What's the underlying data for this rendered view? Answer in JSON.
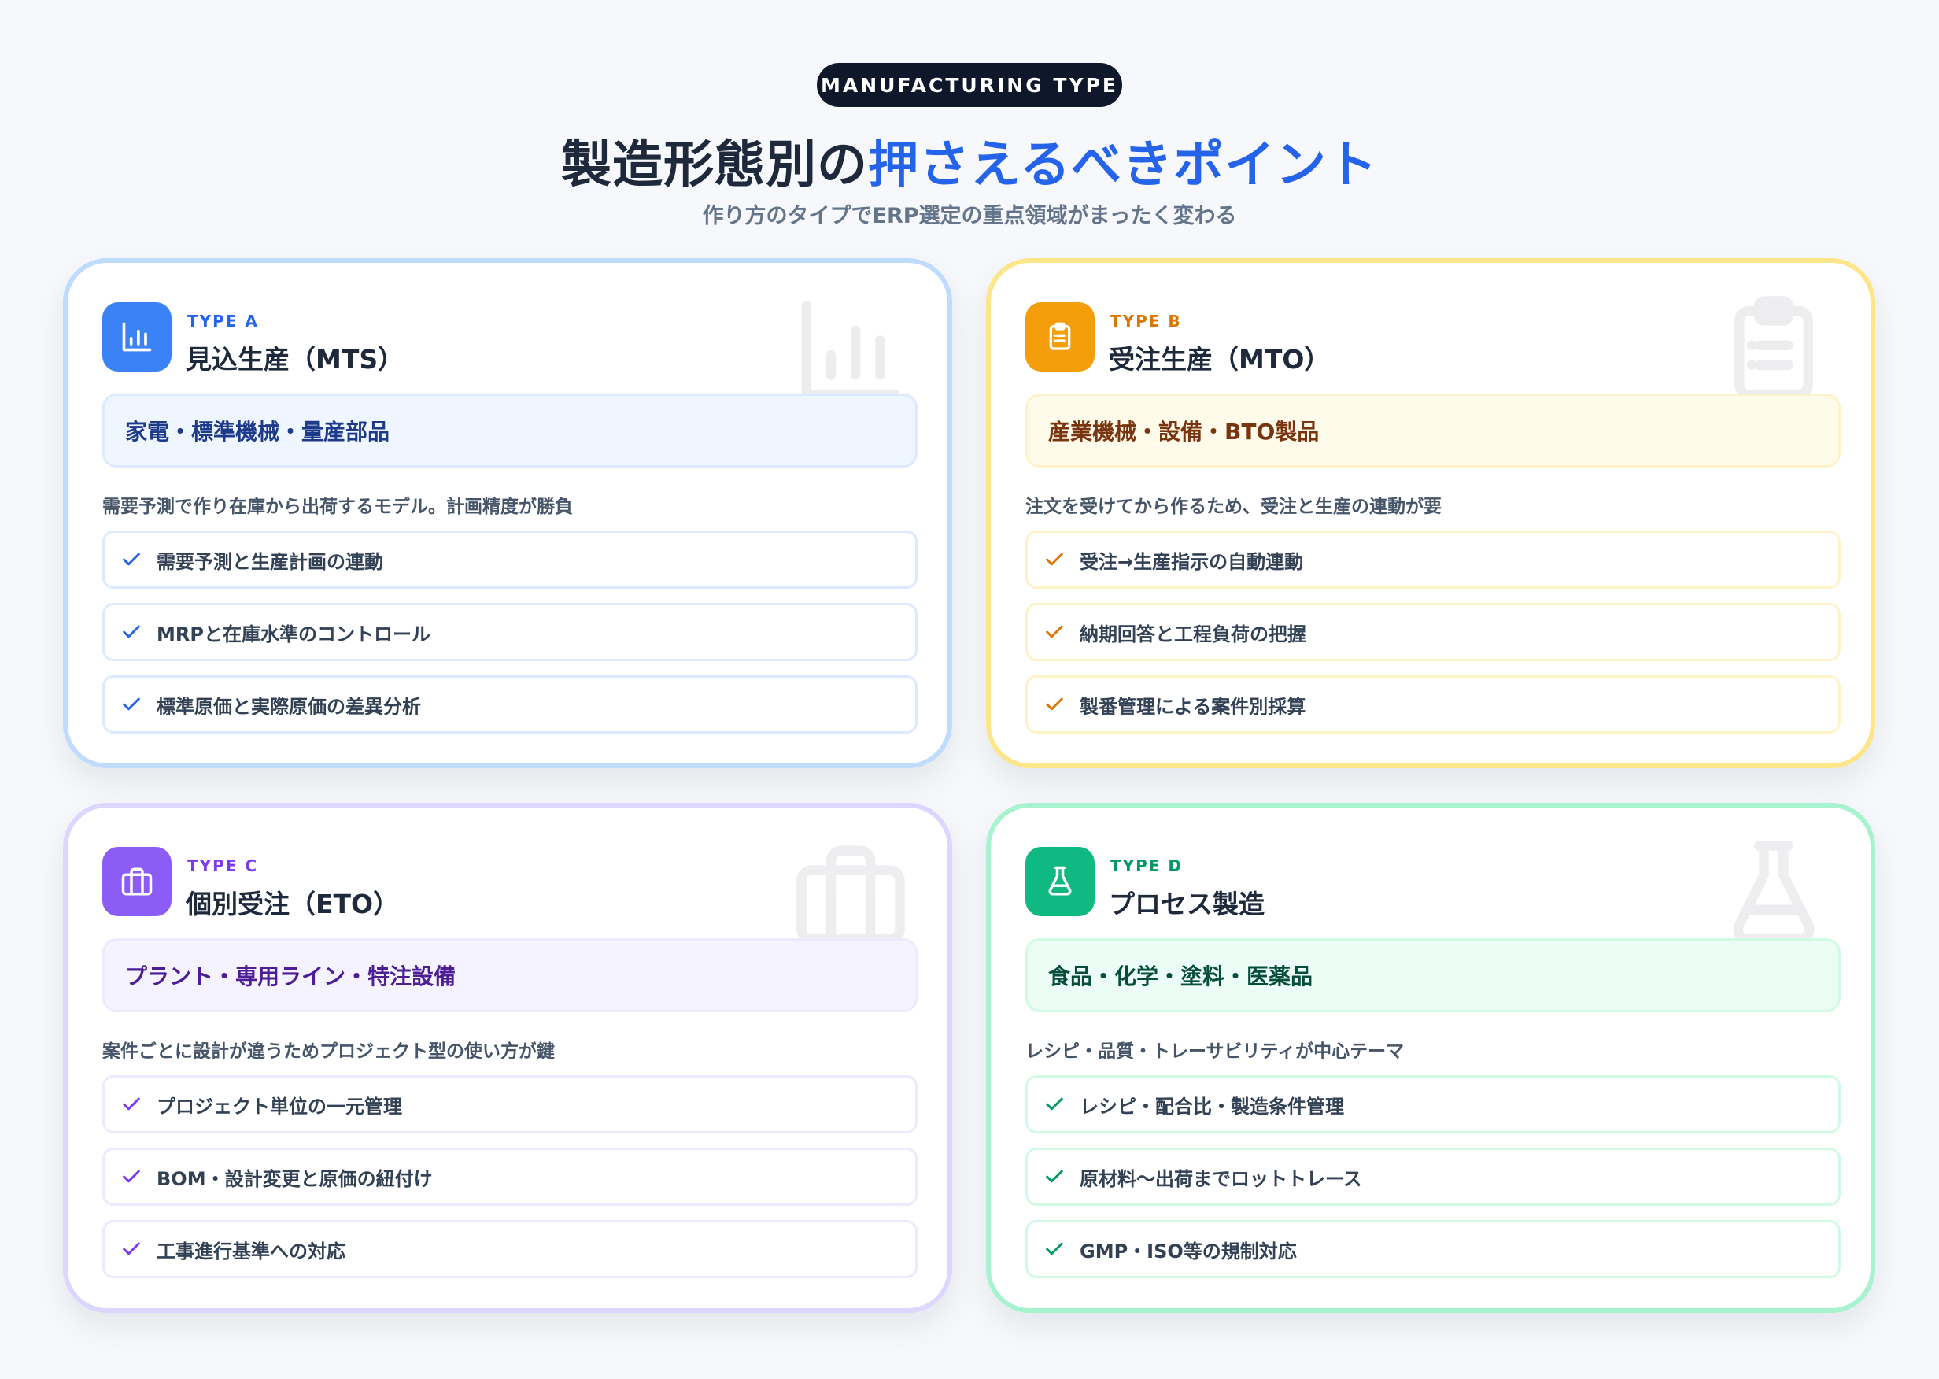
{
  "header": {
    "pill": "MANUFACTURING TYPE",
    "title_main": "製造形態別の",
    "title_accent": "押さえるべきポイント",
    "subtitle": "作り方のタイプでERP選定の重点領域がまったく変わる"
  },
  "cards": [
    {
      "type_label": "TYPE A",
      "title": "見込生産（MTS）",
      "icon": "bar-chart-icon",
      "banner": "家電・標準機械・量産部品",
      "description": "需要予測で作り在庫から出荷するモデル。計画精度が勝負",
      "items": [
        "需要予測と生産計画の連動",
        "MRPと在庫水準のコントロール",
        "標準原価と実際原価の差異分析"
      ],
      "accent": "#3b82f6"
    },
    {
      "type_label": "TYPE B",
      "title": "受注生産（MTO）",
      "icon": "clipboard-icon",
      "banner": "産業機械・設備・BTO製品",
      "description": "注文を受けてから作るため、受注と生産の連動が要",
      "items": [
        "受注→生産指示の自動連動",
        "納期回答と工程負荷の把握",
        "製番管理による案件別採算"
      ],
      "accent": "#f59e0b"
    },
    {
      "type_label": "TYPE C",
      "title": "個別受注（ETO）",
      "icon": "briefcase-icon",
      "banner": "プラント・専用ライン・特注設備",
      "description": "案件ごとに設計が違うためプロジェクト型の使い方が鍵",
      "items": [
        "プロジェクト単位の一元管理",
        "BOM・設計変更と原価の紐付け",
        "工事進行基準への対応"
      ],
      "accent": "#8b5cf6"
    },
    {
      "type_label": "TYPE D",
      "title": "プロセス製造",
      "icon": "flask-icon",
      "banner": "食品・化学・塗料・医薬品",
      "description": "レシピ・品質・トレーサビリティが中心テーマ",
      "items": [
        "レシピ・配合比・製造条件管理",
        "原材料〜出荷までロットトレース",
        "GMP・ISO等の規制対応"
      ],
      "accent": "#10b981"
    }
  ]
}
